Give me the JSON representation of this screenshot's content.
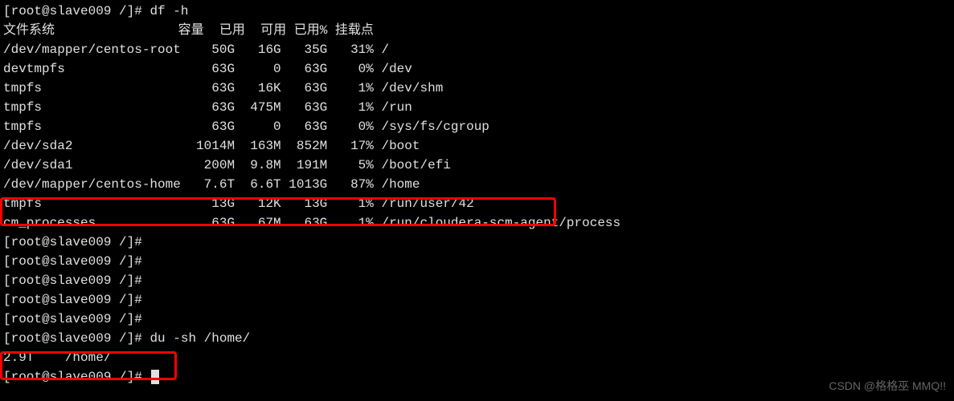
{
  "prompt_prefix": "[root@slave009 /]#",
  "commands": {
    "df": "df -h",
    "du": "du -sh /home/"
  },
  "df_header": {
    "filesystem": "文件系统",
    "size": "容量",
    "used": "已用",
    "avail": "可用",
    "use_pct": "已用%",
    "mount": "挂载点"
  },
  "df_rows": [
    {
      "fs": "/dev/mapper/centos-root",
      "size": "50G",
      "used": "16G",
      "avail": "35G",
      "pct": "31%",
      "mount": "/"
    },
    {
      "fs": "devtmpfs",
      "size": "63G",
      "used": "0",
      "avail": "63G",
      "pct": "0%",
      "mount": "/dev"
    },
    {
      "fs": "tmpfs",
      "size": "63G",
      "used": "16K",
      "avail": "63G",
      "pct": "1%",
      "mount": "/dev/shm"
    },
    {
      "fs": "tmpfs",
      "size": "63G",
      "used": "475M",
      "avail": "63G",
      "pct": "1%",
      "mount": "/run"
    },
    {
      "fs": "tmpfs",
      "size": "63G",
      "used": "0",
      "avail": "63G",
      "pct": "0%",
      "mount": "/sys/fs/cgroup"
    },
    {
      "fs": "/dev/sda2",
      "size": "1014M",
      "used": "163M",
      "avail": "852M",
      "pct": "17%",
      "mount": "/boot"
    },
    {
      "fs": "/dev/sda1",
      "size": "200M",
      "used": "9.8M",
      "avail": "191M",
      "pct": "5%",
      "mount": "/boot/efi"
    },
    {
      "fs": "/dev/mapper/centos-home",
      "size": "7.6T",
      "used": "6.6T",
      "avail": "1013G",
      "pct": "87%",
      "mount": "/home"
    },
    {
      "fs": "tmpfs",
      "size": "13G",
      "used": "12K",
      "avail": "13G",
      "pct": "1%",
      "mount": "/run/user/42"
    },
    {
      "fs": "cm_processes",
      "size": "63G",
      "used": "67M",
      "avail": "63G",
      "pct": "1%",
      "mount": "/run/cloudera-scm-agent/process"
    }
  ],
  "du_output": {
    "size": "2.9T",
    "path": "/home/"
  },
  "watermark": "CSDN @格格巫 MMQ!!"
}
